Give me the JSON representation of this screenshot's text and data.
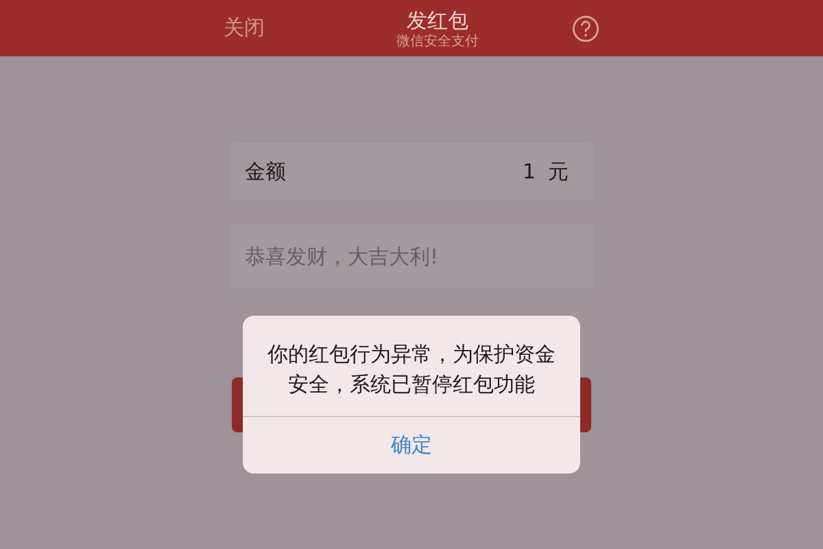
{
  "header": {
    "close": "关闭",
    "title": "发红包",
    "subtitle": "微信安全支付"
  },
  "amount": {
    "label": "金额",
    "value": "1",
    "unit": "元"
  },
  "message": {
    "placeholder": "恭喜发财，大吉大利!"
  },
  "dialog": {
    "message": "你的红包行为异常，为保护资金安全，系统已暂停红包功能",
    "button": "确定"
  }
}
